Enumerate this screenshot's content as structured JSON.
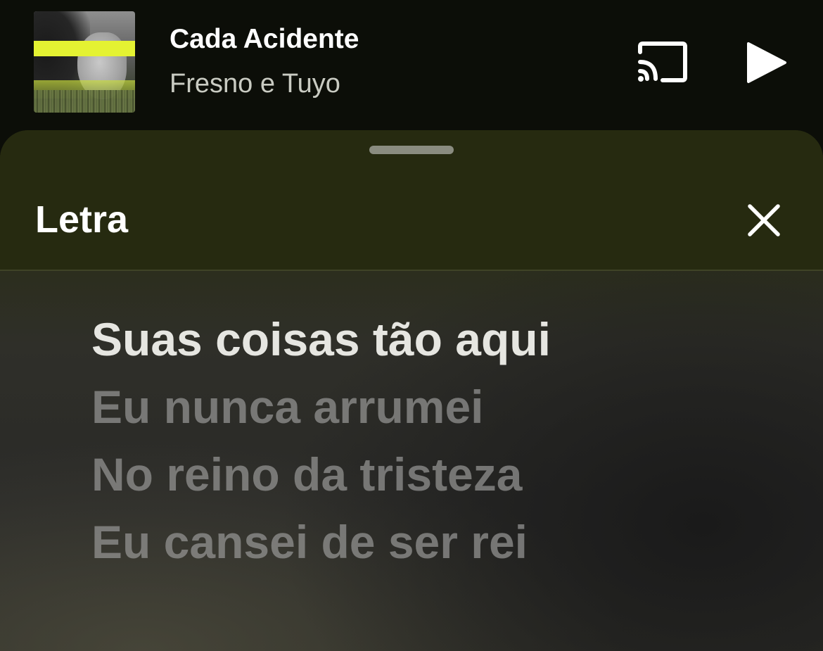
{
  "player": {
    "title": "Cada Acidente",
    "artist": "Fresno e Tuyo",
    "album_art_icon": "album-cover",
    "cast_icon": "cast-icon",
    "play_icon": "play-icon"
  },
  "lyrics_sheet": {
    "title": "Letra",
    "close_icon": "close-icon",
    "lines": [
      {
        "text": "Suas coisas tão aqui",
        "active": true
      },
      {
        "text": "Eu nunca arrumei",
        "active": false
      },
      {
        "text": "No reino da tristeza",
        "active": false
      },
      {
        "text": "Eu cansei de ser rei",
        "active": false
      }
    ]
  },
  "colors": {
    "player_background": "#0c0e08",
    "sheet_header": "#262a10",
    "accent_yellow": "#e4f232",
    "text_primary": "#ffffff",
    "text_secondary": "#c9cbc2"
  }
}
